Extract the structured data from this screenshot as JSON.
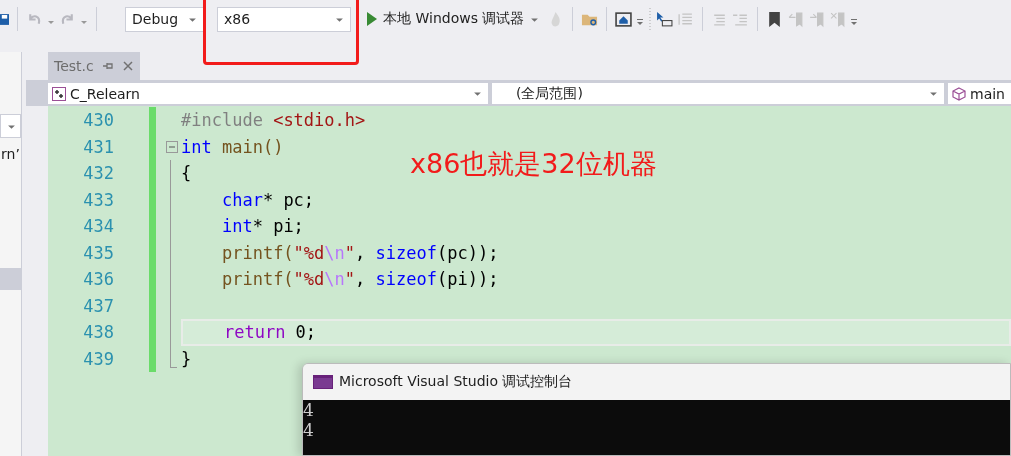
{
  "toolbar": {
    "configuration": "Debug",
    "platform": "x86",
    "run_button": "本地 Windows 调试器"
  },
  "side_panel": {
    "fragment": "rn’"
  },
  "tabs": [
    {
      "label": "Test.c",
      "selected": true
    }
  ],
  "nav_bar": {
    "project": "C_Relearn",
    "scope": "(全局范围)",
    "member": "main"
  },
  "editor": {
    "lines": [
      {
        "number": "430",
        "collapsible": false,
        "in_block": false,
        "current": false,
        "tokens": [
          {
            "text": "#include ",
            "kind": "preproc"
          },
          {
            "text": "<stdio.h>",
            "kind": "string"
          }
        ]
      },
      {
        "number": "431",
        "collapsible": true,
        "in_block": false,
        "current": false,
        "tokens": [
          {
            "text": "int",
            "kind": "keyword"
          },
          {
            "text": " main()",
            "kind": "func"
          }
        ]
      },
      {
        "number": "432",
        "collapsible": false,
        "in_block": true,
        "current": false,
        "tokens": [
          {
            "text": "{",
            "kind": "plain"
          }
        ]
      },
      {
        "number": "433",
        "collapsible": false,
        "in_block": true,
        "current": false,
        "tokens": [
          {
            "text": "    char",
            "kind": "keyword"
          },
          {
            "text": "* pc;",
            "kind": "plain"
          }
        ]
      },
      {
        "number": "434",
        "collapsible": false,
        "in_block": true,
        "current": false,
        "tokens": [
          {
            "text": "    int",
            "kind": "keyword"
          },
          {
            "text": "* pi;",
            "kind": "plain"
          }
        ]
      },
      {
        "number": "435",
        "collapsible": false,
        "in_block": true,
        "current": false,
        "tokens": [
          {
            "text": "    printf(",
            "kind": "func"
          },
          {
            "text": "\"%d",
            "kind": "string"
          },
          {
            "text": "\\n",
            "kind": "escape"
          },
          {
            "text": "\"",
            "kind": "string"
          },
          {
            "text": ", ",
            "kind": "plain"
          },
          {
            "text": "sizeof",
            "kind": "keyword"
          },
          {
            "text": "(pc));",
            "kind": "plain"
          }
        ]
      },
      {
        "number": "436",
        "collapsible": false,
        "in_block": true,
        "current": false,
        "tokens": [
          {
            "text": "    printf(",
            "kind": "func"
          },
          {
            "text": "\"%d",
            "kind": "string"
          },
          {
            "text": "\\n",
            "kind": "escape"
          },
          {
            "text": "\"",
            "kind": "string"
          },
          {
            "text": ", ",
            "kind": "plain"
          },
          {
            "text": "sizeof",
            "kind": "keyword"
          },
          {
            "text": "(pi));",
            "kind": "plain"
          }
        ]
      },
      {
        "number": "437",
        "collapsible": false,
        "in_block": true,
        "current": false
      },
      {
        "number": "438",
        "collapsible": false,
        "in_block": true,
        "current": true,
        "tokens": [
          {
            "text": "    return",
            "kind": "control"
          },
          {
            "text": " 0;",
            "kind": "plain"
          }
        ]
      },
      {
        "number": "439",
        "collapsible": false,
        "in_block": true,
        "current": false,
        "tokens": [
          {
            "text": "}",
            "kind": "plain"
          }
        ]
      }
    ]
  },
  "annotation": "x86也就是32位机器",
  "console": {
    "title": "Microsoft Visual Studio 调试控制台",
    "output": [
      "4",
      "4"
    ]
  }
}
